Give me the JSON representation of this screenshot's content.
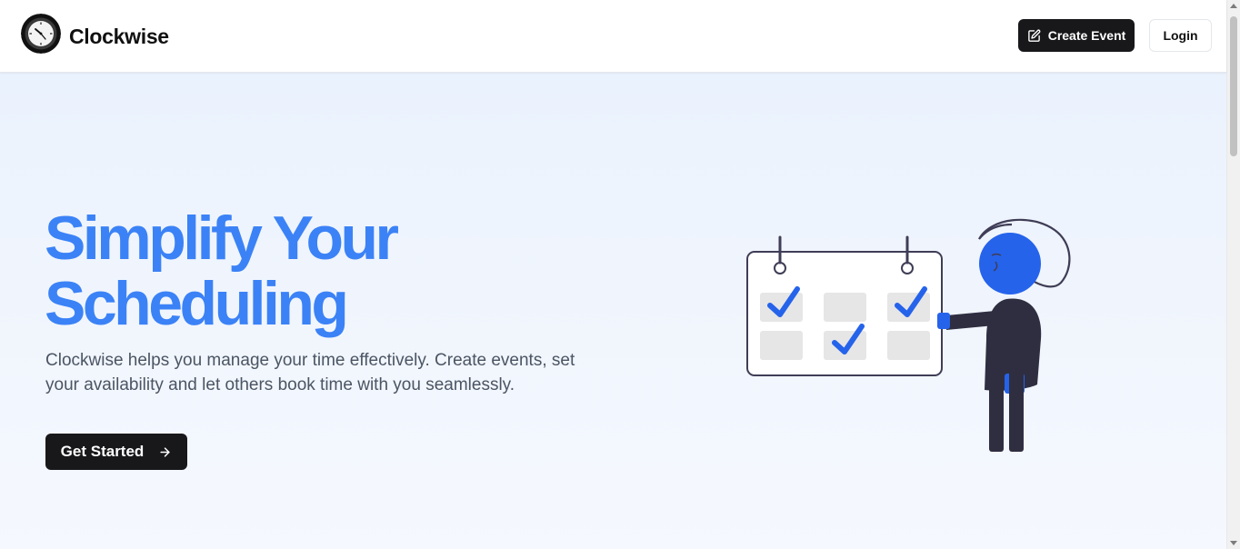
{
  "header": {
    "brand": "Clockwise",
    "logo_icon": "clock-logo-icon",
    "create_event_label": "Create Event",
    "create_event_icon": "edit-icon",
    "login_label": "Login"
  },
  "hero": {
    "title": "Simplify Your Scheduling",
    "subtitle": "Clockwise helps you manage your time effectively. Create events, set your availability and let others book time with you seamlessly.",
    "cta_label": "Get Started",
    "cta_icon": "arrow-right-icon",
    "illustration": "calendar-checklist-illustration"
  },
  "colors": {
    "accent": "#3b82f6",
    "illustration_blue": "#2563eb",
    "dark": "#18181b",
    "background": "#eef4fd"
  }
}
